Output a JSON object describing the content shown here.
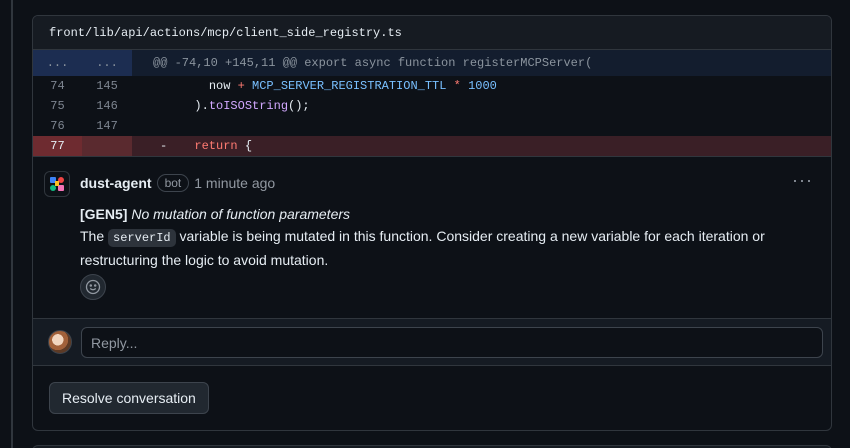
{
  "file": {
    "path": "front/lib/api/actions/mcp/client_side_registry.ts"
  },
  "diff": {
    "hunk": {
      "left": "...",
      "right": "...",
      "text": "@@ -74,10 +145,11 @@ export async function registerMCPServer("
    },
    "rows": [
      {
        "left": "74",
        "right": "145",
        "indent": "    ",
        "t1": "now ",
        "t2": "+ ",
        "t3": "MCP_SERVER_REGISTRATION_TTL",
        "t4": " * ",
        "t5": "1000"
      },
      {
        "left": "75",
        "right": "146",
        "indent": "  ",
        "t1": ").",
        "t2": "toISOString",
        "t3": "();"
      },
      {
        "left": "76",
        "right": "147"
      },
      {
        "left": "77",
        "right": "",
        "marker": "-",
        "kw": "return",
        "rest": " {"
      }
    ]
  },
  "comment": {
    "author": "dust-agent",
    "badge": "bot",
    "time": "1 minute ago",
    "more": "···",
    "tag": "[GEN5]",
    "title": "No mutation of function parameters",
    "body_pre": "The ",
    "code": "serverId",
    "body_post": " variable is being mutated in this function. Consider creating a new variable for each iteration or restructuring the logic to avoid mutation."
  },
  "reply": {
    "placeholder": "Reply..."
  },
  "resolve": {
    "label": "Resolve conversation"
  },
  "icons": {
    "bot_logo": "dust-logo-icon",
    "reaction": "smiley-icon",
    "more": "kebab-horizontal-icon"
  },
  "colors": {
    "deleted_row": "#3a1f26",
    "hunk_row": "#131d2e",
    "accent_blue": "#79c0ff"
  }
}
